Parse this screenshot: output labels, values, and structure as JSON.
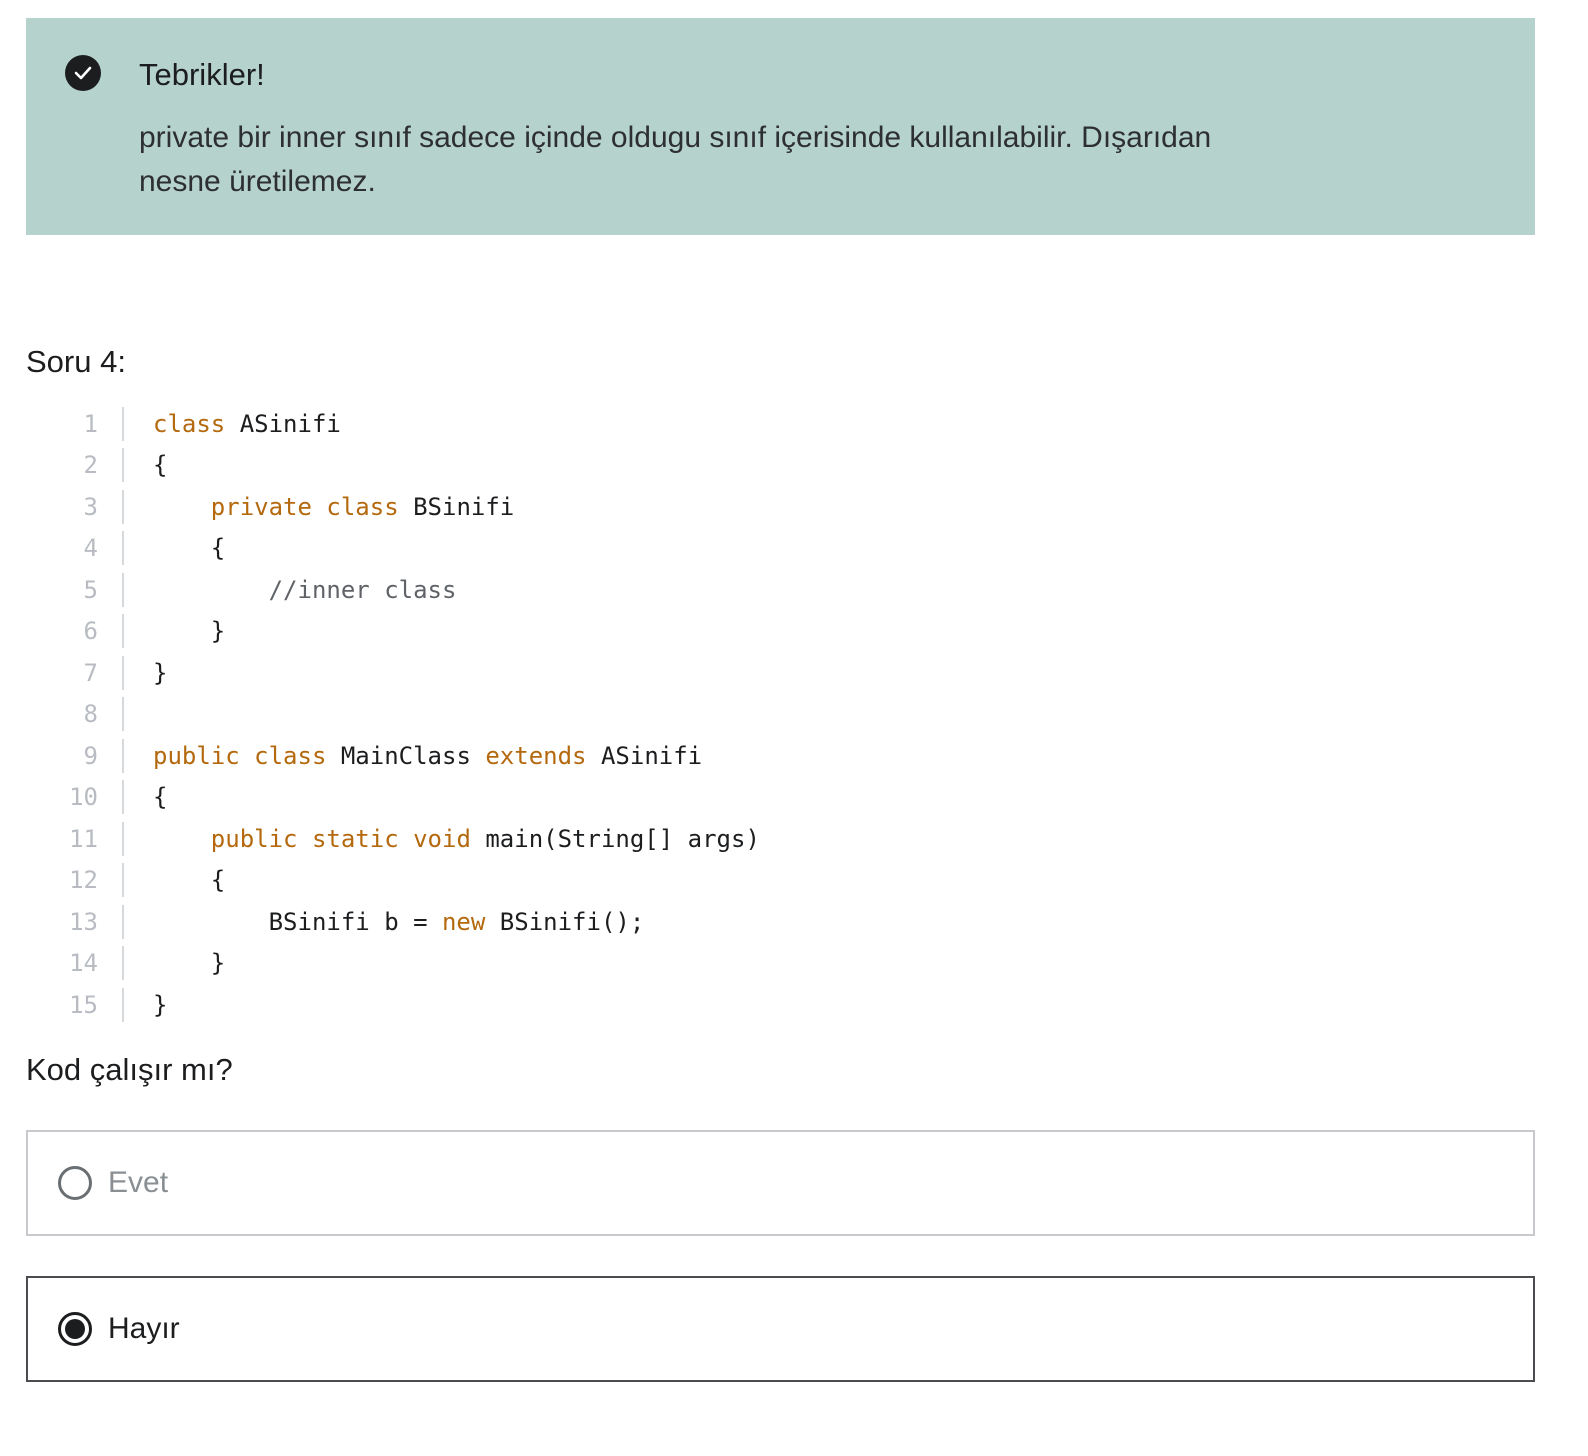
{
  "alert": {
    "icon": "check-circle-icon",
    "title": "Tebrikler!",
    "text": "private bir inner sınıf sadece içinde oldugu sınıf içerisinde kullanılabilir. Dışarıdan nesne üretilemez."
  },
  "question": {
    "title": "Soru 4:",
    "prompt": "Kod çalışır mı?"
  },
  "code": {
    "language": "java",
    "lines": [
      {
        "n": "1",
        "tokens": [
          {
            "t": "class",
            "k": "kw"
          },
          {
            "t": " ASinifi"
          }
        ]
      },
      {
        "n": "2",
        "tokens": [
          {
            "t": "{"
          }
        ]
      },
      {
        "n": "3",
        "tokens": [
          {
            "t": "    "
          },
          {
            "t": "private",
            "k": "kw"
          },
          {
            "t": " "
          },
          {
            "t": "class",
            "k": "kw"
          },
          {
            "t": " BSinifi"
          }
        ]
      },
      {
        "n": "4",
        "tokens": [
          {
            "t": "    {"
          }
        ]
      },
      {
        "n": "5",
        "tokens": [
          {
            "t": "        "
          },
          {
            "t": "//inner class",
            "k": "cm"
          }
        ]
      },
      {
        "n": "6",
        "tokens": [
          {
            "t": "    }"
          }
        ]
      },
      {
        "n": "7",
        "tokens": [
          {
            "t": "}"
          }
        ]
      },
      {
        "n": "8",
        "tokens": [
          {
            "t": ""
          }
        ]
      },
      {
        "n": "9",
        "tokens": [
          {
            "t": "public",
            "k": "kw"
          },
          {
            "t": " "
          },
          {
            "t": "class",
            "k": "kw"
          },
          {
            "t": " MainClass "
          },
          {
            "t": "extends",
            "k": "kw"
          },
          {
            "t": " ASinifi"
          }
        ]
      },
      {
        "n": "10",
        "tokens": [
          {
            "t": "{"
          }
        ]
      },
      {
        "n": "11",
        "tokens": [
          {
            "t": "    "
          },
          {
            "t": "public",
            "k": "kw"
          },
          {
            "t": " "
          },
          {
            "t": "static",
            "k": "kw"
          },
          {
            "t": " "
          },
          {
            "t": "void",
            "k": "kw"
          },
          {
            "t": " main(String[] args)"
          }
        ]
      },
      {
        "n": "12",
        "tokens": [
          {
            "t": "    {"
          }
        ]
      },
      {
        "n": "13",
        "tokens": [
          {
            "t": "        BSinifi b = "
          },
          {
            "t": "new",
            "k": "kw"
          },
          {
            "t": " BSinifi();"
          }
        ]
      },
      {
        "n": "14",
        "tokens": [
          {
            "t": "    }"
          }
        ]
      },
      {
        "n": "15",
        "tokens": [
          {
            "t": "}"
          }
        ]
      }
    ]
  },
  "options": [
    {
      "label": "Evet",
      "selected": false
    },
    {
      "label": "Hayır",
      "selected": true
    }
  ],
  "colors": {
    "alert_bg": "#b5d2cc",
    "keyword": "#b4690e",
    "comment": "#5f6368",
    "line_number": "#b8bcc2"
  }
}
